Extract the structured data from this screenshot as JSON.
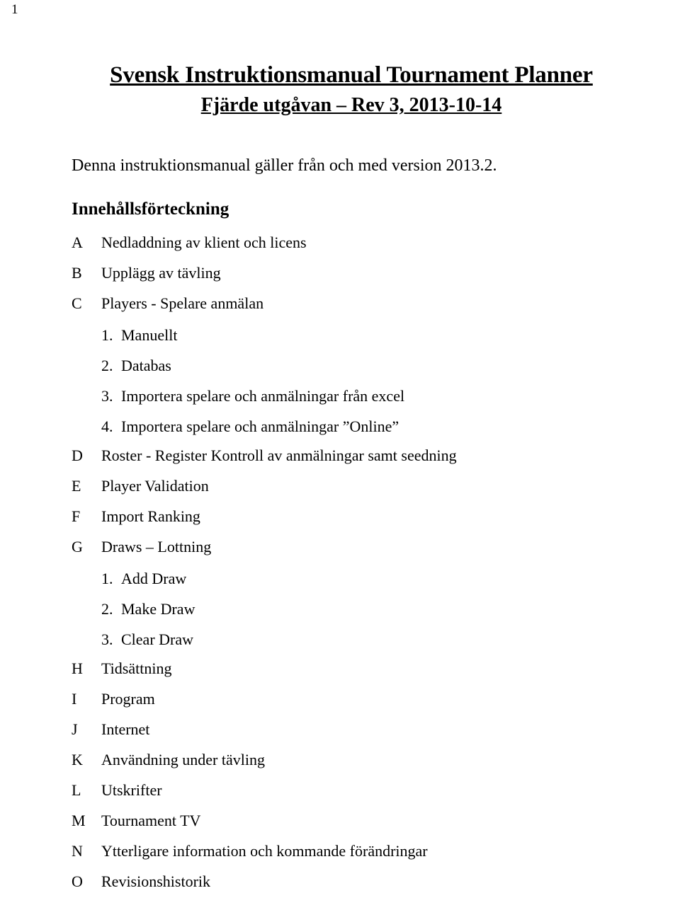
{
  "page": {
    "number": "1"
  },
  "title": {
    "main": "Svensk Instruktionsmanual Tournament Planner",
    "sub": "Fjärde utgåvan – Rev 3, 2013-10-14"
  },
  "intro": "Denna instruktionsmanual gäller från och med version 2013.2.",
  "toc": {
    "heading": "Innehållsförteckning",
    "entries": [
      {
        "letter": "A",
        "label": "Nedladdning av klient och licens"
      },
      {
        "letter": "B",
        "label": "Upplägg av tävling"
      },
      {
        "letter": "C",
        "label": "Players - Spelare anmälan"
      },
      {
        "num": "1.",
        "label": "Manuellt"
      },
      {
        "num": "2.",
        "label": "Databas"
      },
      {
        "num": "3.",
        "label": "Importera spelare och anmälningar från excel"
      },
      {
        "num": "4.",
        "label": "Importera spelare och anmälningar ”Online”"
      },
      {
        "letter": "D",
        "label": "Roster - Register Kontroll av anmälningar samt seedning"
      },
      {
        "letter": "E",
        "label": "Player Validation"
      },
      {
        "letter": "F",
        "label": "Import Ranking"
      },
      {
        "letter": "G",
        "label": "Draws – Lottning"
      },
      {
        "num": "1.",
        "label": "Add Draw"
      },
      {
        "num": "2.",
        "label": "Make Draw"
      },
      {
        "num": "3.",
        "label": "Clear Draw"
      },
      {
        "letter": "H",
        "label": "Tidsättning"
      },
      {
        "letter": "I",
        "label": "Program"
      },
      {
        "letter": "J",
        "label": "Internet"
      },
      {
        "letter": "K",
        "label": "Användning under tävling"
      },
      {
        "letter": "L",
        "label": "Utskrifter"
      },
      {
        "letter": "M",
        "label": "Tournament TV"
      },
      {
        "letter": "N",
        "label": "Ytterligare information och kommande förändringar"
      },
      {
        "letter": "O",
        "label": "Revisionshistorik"
      }
    ]
  }
}
